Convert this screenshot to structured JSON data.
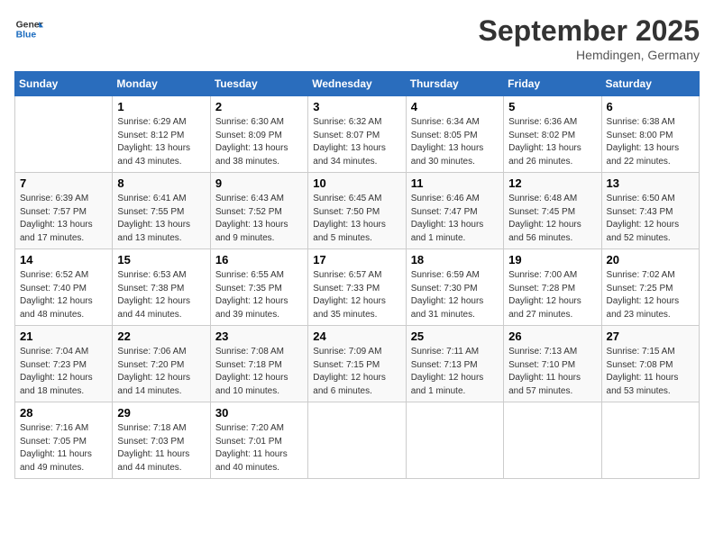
{
  "header": {
    "logo_line1": "General",
    "logo_line2": "Blue",
    "month": "September 2025",
    "location": "Hemdingen, Germany"
  },
  "weekdays": [
    "Sunday",
    "Monday",
    "Tuesday",
    "Wednesday",
    "Thursday",
    "Friday",
    "Saturday"
  ],
  "weeks": [
    [
      {
        "day": "",
        "info": ""
      },
      {
        "day": "1",
        "info": "Sunrise: 6:29 AM\nSunset: 8:12 PM\nDaylight: 13 hours\nand 43 minutes."
      },
      {
        "day": "2",
        "info": "Sunrise: 6:30 AM\nSunset: 8:09 PM\nDaylight: 13 hours\nand 38 minutes."
      },
      {
        "day": "3",
        "info": "Sunrise: 6:32 AM\nSunset: 8:07 PM\nDaylight: 13 hours\nand 34 minutes."
      },
      {
        "day": "4",
        "info": "Sunrise: 6:34 AM\nSunset: 8:05 PM\nDaylight: 13 hours\nand 30 minutes."
      },
      {
        "day": "5",
        "info": "Sunrise: 6:36 AM\nSunset: 8:02 PM\nDaylight: 13 hours\nand 26 minutes."
      },
      {
        "day": "6",
        "info": "Sunrise: 6:38 AM\nSunset: 8:00 PM\nDaylight: 13 hours\nand 22 minutes."
      }
    ],
    [
      {
        "day": "7",
        "info": "Sunrise: 6:39 AM\nSunset: 7:57 PM\nDaylight: 13 hours\nand 17 minutes."
      },
      {
        "day": "8",
        "info": "Sunrise: 6:41 AM\nSunset: 7:55 PM\nDaylight: 13 hours\nand 13 minutes."
      },
      {
        "day": "9",
        "info": "Sunrise: 6:43 AM\nSunset: 7:52 PM\nDaylight: 13 hours\nand 9 minutes."
      },
      {
        "day": "10",
        "info": "Sunrise: 6:45 AM\nSunset: 7:50 PM\nDaylight: 13 hours\nand 5 minutes."
      },
      {
        "day": "11",
        "info": "Sunrise: 6:46 AM\nSunset: 7:47 PM\nDaylight: 13 hours\nand 1 minute."
      },
      {
        "day": "12",
        "info": "Sunrise: 6:48 AM\nSunset: 7:45 PM\nDaylight: 12 hours\nand 56 minutes."
      },
      {
        "day": "13",
        "info": "Sunrise: 6:50 AM\nSunset: 7:43 PM\nDaylight: 12 hours\nand 52 minutes."
      }
    ],
    [
      {
        "day": "14",
        "info": "Sunrise: 6:52 AM\nSunset: 7:40 PM\nDaylight: 12 hours\nand 48 minutes."
      },
      {
        "day": "15",
        "info": "Sunrise: 6:53 AM\nSunset: 7:38 PM\nDaylight: 12 hours\nand 44 minutes."
      },
      {
        "day": "16",
        "info": "Sunrise: 6:55 AM\nSunset: 7:35 PM\nDaylight: 12 hours\nand 39 minutes."
      },
      {
        "day": "17",
        "info": "Sunrise: 6:57 AM\nSunset: 7:33 PM\nDaylight: 12 hours\nand 35 minutes."
      },
      {
        "day": "18",
        "info": "Sunrise: 6:59 AM\nSunset: 7:30 PM\nDaylight: 12 hours\nand 31 minutes."
      },
      {
        "day": "19",
        "info": "Sunrise: 7:00 AM\nSunset: 7:28 PM\nDaylight: 12 hours\nand 27 minutes."
      },
      {
        "day": "20",
        "info": "Sunrise: 7:02 AM\nSunset: 7:25 PM\nDaylight: 12 hours\nand 23 minutes."
      }
    ],
    [
      {
        "day": "21",
        "info": "Sunrise: 7:04 AM\nSunset: 7:23 PM\nDaylight: 12 hours\nand 18 minutes."
      },
      {
        "day": "22",
        "info": "Sunrise: 7:06 AM\nSunset: 7:20 PM\nDaylight: 12 hours\nand 14 minutes."
      },
      {
        "day": "23",
        "info": "Sunrise: 7:08 AM\nSunset: 7:18 PM\nDaylight: 12 hours\nand 10 minutes."
      },
      {
        "day": "24",
        "info": "Sunrise: 7:09 AM\nSunset: 7:15 PM\nDaylight: 12 hours\nand 6 minutes."
      },
      {
        "day": "25",
        "info": "Sunrise: 7:11 AM\nSunset: 7:13 PM\nDaylight: 12 hours\nand 1 minute."
      },
      {
        "day": "26",
        "info": "Sunrise: 7:13 AM\nSunset: 7:10 PM\nDaylight: 11 hours\nand 57 minutes."
      },
      {
        "day": "27",
        "info": "Sunrise: 7:15 AM\nSunset: 7:08 PM\nDaylight: 11 hours\nand 53 minutes."
      }
    ],
    [
      {
        "day": "28",
        "info": "Sunrise: 7:16 AM\nSunset: 7:05 PM\nDaylight: 11 hours\nand 49 minutes."
      },
      {
        "day": "29",
        "info": "Sunrise: 7:18 AM\nSunset: 7:03 PM\nDaylight: 11 hours\nand 44 minutes."
      },
      {
        "day": "30",
        "info": "Sunrise: 7:20 AM\nSunset: 7:01 PM\nDaylight: 11 hours\nand 40 minutes."
      },
      {
        "day": "",
        "info": ""
      },
      {
        "day": "",
        "info": ""
      },
      {
        "day": "",
        "info": ""
      },
      {
        "day": "",
        "info": ""
      }
    ]
  ]
}
